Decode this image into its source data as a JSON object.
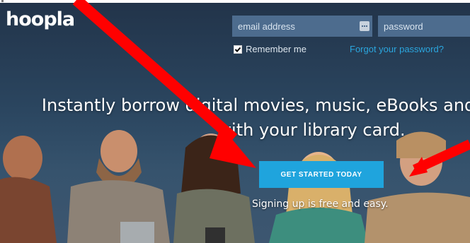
{
  "brand": {
    "logo": "hoopla"
  },
  "login": {
    "email_placeholder": "email address",
    "password_placeholder": "password",
    "remember_label": "Remember me",
    "remember_checked": true,
    "forgot_label": "Forgot your password?"
  },
  "hero": {
    "headline_line1": "Instantly borrow digital movies, music, eBooks and more",
    "headline_line2": "with your library card.",
    "cta_label": "GET STARTED TODAY",
    "signup_note": "Signing up is free and easy."
  },
  "colors": {
    "accent": "#1fa4dd",
    "link": "#2ba6de",
    "field_bg": "#4d6c8e",
    "annotation_arrow": "#ff0000"
  },
  "icons": {
    "field_menu": "kebab-menu-icon",
    "remember_checkbox": "checkmark-icon"
  },
  "annotations": {
    "arrow_count": 2
  }
}
